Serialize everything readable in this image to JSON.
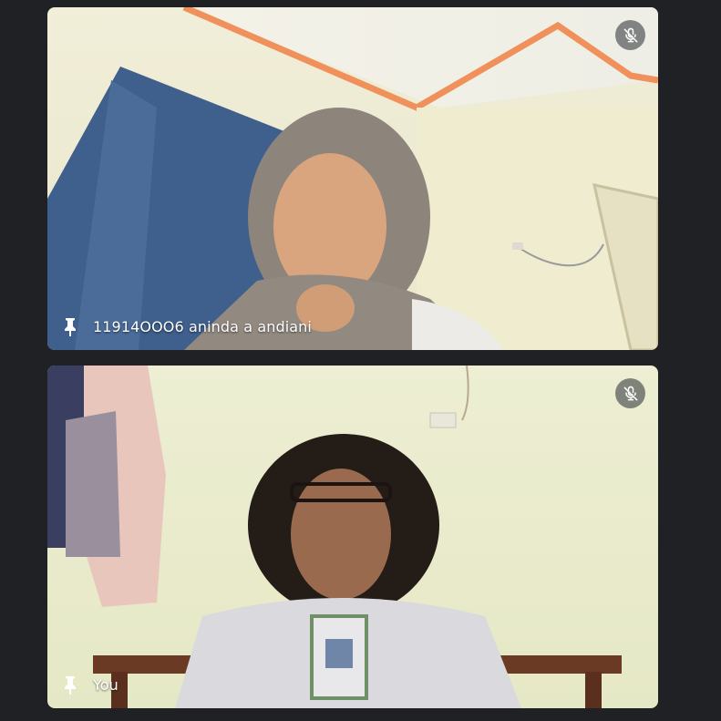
{
  "participants": [
    {
      "name": "11914OOO6 aninda a andiani",
      "pin_icon": "pin-icon",
      "status_icon": "mic-off-icon"
    },
    {
      "name": "You",
      "pin_icon": "pin-icon",
      "status_icon": "mic-off-icon"
    }
  ],
  "colors": {
    "background": "#202124",
    "trim": "#f0905a",
    "curtain": "#3f5f8c",
    "wall_top": "#ece9d2",
    "wall_bottom": "#e6e8c8"
  }
}
